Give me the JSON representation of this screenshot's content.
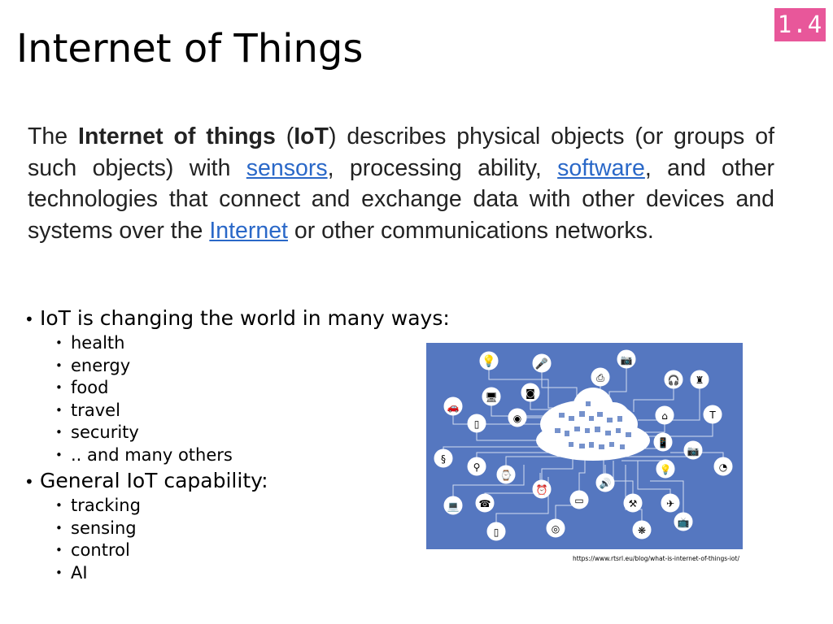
{
  "slide_number": "1.4",
  "title": "Internet of Things",
  "intro": {
    "t1": "The ",
    "b1": "Internet of things",
    "t2": " (",
    "b2": "IoT",
    "t3": ") describes physical objects (or groups of such objects) with ",
    "link1": "sensors",
    "t4": ", processing ability, ",
    "link2": "software",
    "t5": ", and other technologies that connect and exchange data with other devices and systems over the ",
    "link3": "Internet",
    "t6": " or other communications networks."
  },
  "bullets": [
    {
      "text": "IoT is changing the world in many ways:",
      "sub": [
        "health",
        "energy",
        "food",
        "travel",
        "security",
        ".. and many others"
      ]
    },
    {
      "text": "General IoT capability:",
      "sub": [
        "tracking",
        "sensing",
        "control",
        "AI"
      ]
    }
  ],
  "figure": {
    "background": "#5577c0",
    "icons": [
      "lamp-icon",
      "microphone-icon",
      "camera-icon",
      "printer-icon",
      "headphones-icon",
      "blender-icon",
      "car-icon",
      "monitor-icon",
      "washing-machine-icon",
      "cloud-icon",
      "router-icon",
      "floor-lamp-icon",
      "fridge-icon",
      "mobile-phone-icon",
      "photo-camera-icon",
      "dna-icon",
      "desk-lamp-icon",
      "watch-icon",
      "light-bulb-icon",
      "gauge-icon",
      "clock-icon",
      "tablet-icon",
      "speaker-icon",
      "telephone-icon",
      "laptop-icon",
      "drill-icon",
      "airplane-icon",
      "tv-icon",
      "tablet-small-icon",
      "webcam-icon",
      "fan-icon"
    ]
  },
  "credit": "https://www.rtsrl.eu/blog/what-is-internet-of-things-iot/"
}
